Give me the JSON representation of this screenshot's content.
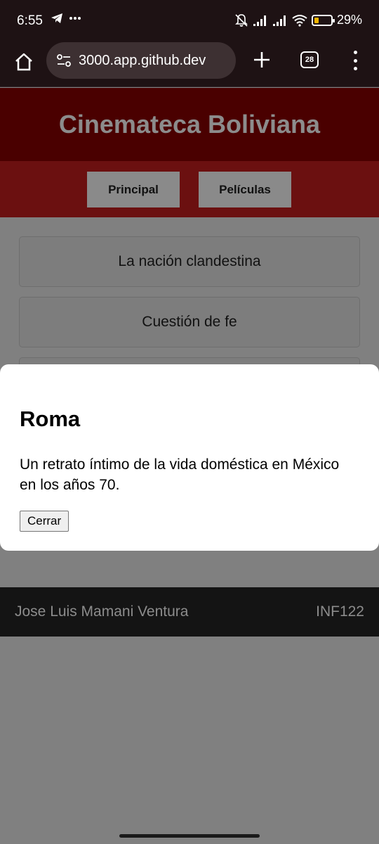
{
  "status_bar": {
    "time": "6:55",
    "battery_percent": "29%",
    "battery_level": 0.29,
    "icons_left": [
      "telegram-icon",
      "more-dots-icon"
    ],
    "icons_right": [
      "bell-off-icon",
      "signal-icon",
      "signal-icon",
      "wifi-icon",
      "battery-icon"
    ]
  },
  "browser": {
    "url": "3000.app.github.dev",
    "tab_count": "28"
  },
  "site": {
    "title": "Cinemateca Boliviana",
    "nav": [
      "Principal",
      "Películas"
    ],
    "movies": [
      "La nación clandestina",
      "Cuestión de fe"
    ]
  },
  "modal": {
    "title": "Roma",
    "description": "Un retrato íntimo de la vida doméstica en México en los años 70.",
    "close_label": "Cerrar"
  },
  "footer": {
    "author": "Jose Luis Mamani Ventura",
    "course": "INF122"
  },
  "colors": {
    "header_bg": "#4a0000",
    "nav_bg": "#6b1010",
    "overlay": "#808080",
    "footer_bg": "#141414",
    "battery_accent": "#f1b400"
  }
}
